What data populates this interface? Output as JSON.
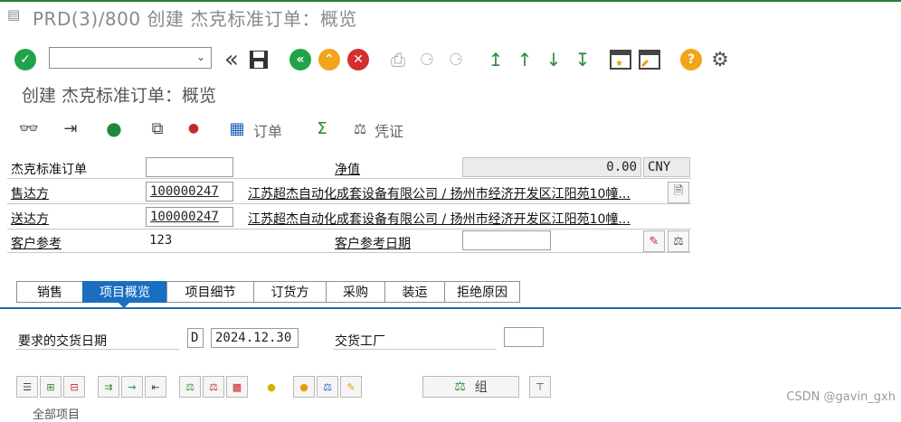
{
  "title_bar": {
    "title": "PRD(3)/800 创建 杰克标准订单：概览"
  },
  "toolbar": {
    "command_field_value": ""
  },
  "subtitle": "创建 杰克标准订单：概览",
  "app_toolbar": {
    "order_label": "订单",
    "voucher_label": "凭证"
  },
  "header": {
    "order_type_label": "杰克标准订单",
    "order_type_value": "",
    "net_value_label": "净值",
    "net_value": "0.00",
    "currency": "CNY",
    "sold_to_label": "售达方",
    "sold_to_value": "100000247",
    "sold_to_desc": "江苏超杰自动化成套设备有限公司 / 扬州市经济开发区江阳苑10幢...",
    "ship_to_label": "送达方",
    "ship_to_value": "100000247",
    "ship_to_desc": "江苏超杰自动化成套设备有限公司 / 扬州市经济开发区江阳苑10幢...",
    "cust_ref_label": "客户参考",
    "cust_ref_value": "123",
    "cust_ref_date_label": "客户参考日期",
    "cust_ref_date_value": ""
  },
  "tabs": [
    {
      "label": "销售"
    },
    {
      "label": "项目概览"
    },
    {
      "label": "项目细节"
    },
    {
      "label": "订货方"
    },
    {
      "label": "采购"
    },
    {
      "label": "装运"
    },
    {
      "label": "拒绝原因"
    }
  ],
  "active_tab": "项目概览",
  "overview": {
    "req_delivery_date_label": "要求的交货日期",
    "date_format": "D",
    "req_delivery_date_value": "2024.12.30",
    "delivering_plant_label": "交货工厂",
    "delivering_plant_value": ""
  },
  "item_toolbar": {
    "group_label": "组"
  },
  "section_label": "全部项目",
  "watermark": "CSDN @gavin_gxh",
  "colors": {
    "accent": "#1a6fc1",
    "ok_green": "#22a34a",
    "cancel_red": "#d32f2f",
    "help_orange": "#f2a51b"
  }
}
